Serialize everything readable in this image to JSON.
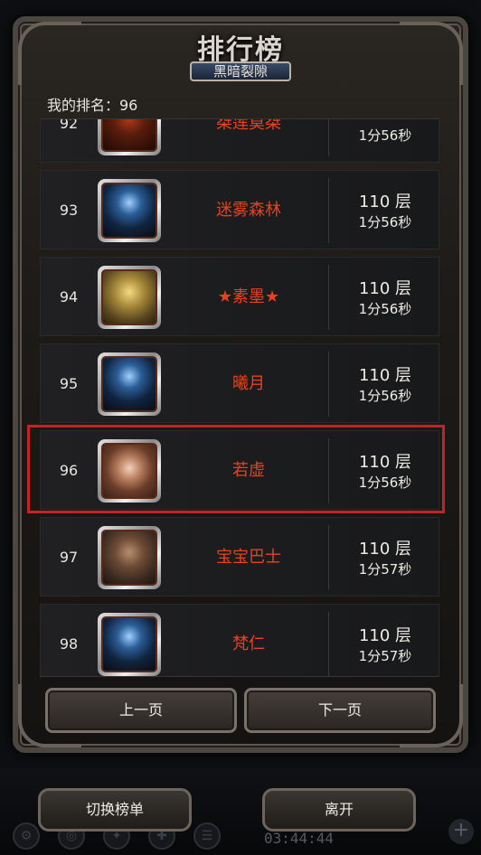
{
  "header": {
    "title": "排行榜",
    "subtitle": "黑暗裂隙"
  },
  "my_rank": "我的排名：96",
  "rows": [
    {
      "rank": "92",
      "name": "桀莲莫桀",
      "floors": "",
      "time": "1分56秒",
      "avatar": "dark-avatar"
    },
    {
      "rank": "93",
      "name": "迷雾森林",
      "floors": "110 层",
      "time": "1分56秒",
      "avatar": "blue-warrior-avatar"
    },
    {
      "rank": "94",
      "name": "★素墨★",
      "floors": "110 层",
      "time": "1分56秒",
      "avatar": "golden-angel-avatar"
    },
    {
      "rank": "95",
      "name": "曦月",
      "floors": "110 层",
      "time": "1分56秒",
      "avatar": "blue-warrior-avatar"
    },
    {
      "rank": "96",
      "name": "若虚",
      "floors": "110 层",
      "time": "1分56秒",
      "avatar": "girl-portrait-avatar"
    },
    {
      "rank": "97",
      "name": "宝宝巴士",
      "floors": "110 层",
      "time": "1分57秒",
      "avatar": "man-portrait-avatar"
    },
    {
      "rank": "98",
      "name": "梵仁",
      "floors": "110 层",
      "time": "1分57秒",
      "avatar": "blue-warrior-avatar"
    }
  ],
  "pagination": {
    "prev_label": "上一页",
    "next_label": "下一页"
  },
  "bottom": {
    "switch_label": "切换榜单",
    "leave_label": "离开",
    "clock": "03:44:44"
  },
  "colors": {
    "name_color": "#e8421f",
    "highlight_border": "#c3222a"
  }
}
